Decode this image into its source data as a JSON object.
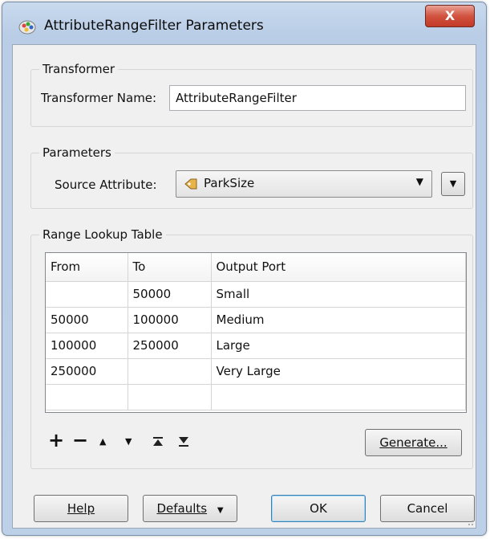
{
  "window": {
    "title": "AttributeRangeFilter Parameters",
    "close_label": "X"
  },
  "transformer_group": {
    "legend": "Transformer",
    "name_label": "Transformer Name:",
    "name_value": "AttributeRangeFilter"
  },
  "parameters_group": {
    "legend": "Parameters",
    "source_label": "Source Attribute:",
    "source_value": "ParkSize"
  },
  "range_group": {
    "legend": "Range Lookup Table",
    "columns": [
      "From",
      "To",
      "Output Port"
    ],
    "rows": [
      [
        "",
        "50000",
        "Small"
      ],
      [
        "50000",
        "100000",
        "Medium"
      ],
      [
        "100000",
        "250000",
        "Large"
      ],
      [
        "250000",
        "",
        "Very Large"
      ],
      [
        "",
        "",
        ""
      ]
    ],
    "generate_label": "Generate..."
  },
  "footer": {
    "help_label": "Help",
    "defaults_label": "Defaults",
    "ok_label": "OK",
    "cancel_label": "Cancel"
  },
  "icons": {
    "add": "add-row-icon",
    "remove": "remove-row-icon",
    "up": "move-up-icon",
    "down": "move-down-icon",
    "top": "move-to-top-icon",
    "bottom": "move-to-bottom-icon",
    "attribute": "attribute-icon",
    "app": "workbench-icon"
  },
  "colors": {
    "titlebar": "#c9daee",
    "close_button": "#d2533f",
    "dialog_background": "#f0f0f0",
    "default_button_border": "#3c7fb1"
  }
}
